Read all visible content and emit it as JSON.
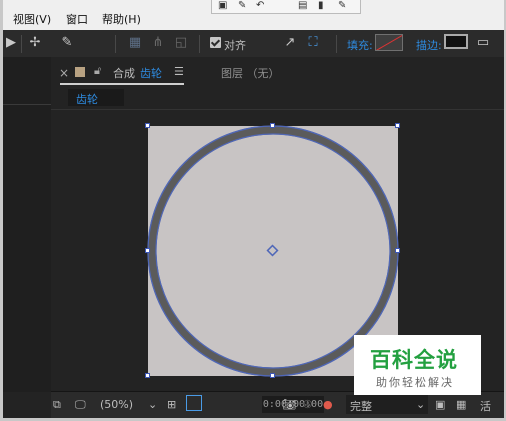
{
  "menu": {
    "items": [
      "视图(V)",
      "窗口",
      "帮助(H)"
    ]
  },
  "toolbar": {
    "align_label": "对齐",
    "fill_label": "填充:",
    "stroke_label": "描边:",
    "tool_icons": [
      "play-icon",
      "puppet-pin-icon",
      "pin-icon",
      "grid-tool-icon",
      "fork-tool-icon",
      "frame-tool-icon",
      "arrow-tool-icon",
      "expand-icon"
    ]
  },
  "panel": {
    "close_glyph": "×",
    "tab_label": "合成",
    "tab_name": "齿轮",
    "menu_glyph": "☰",
    "layer_tab": "图层 （无）",
    "subtab": "齿轮"
  },
  "statusbar": {
    "zoom": "(50%)",
    "timecode": "0:00:00:00",
    "quality": "完整",
    "trailing_text": "活"
  },
  "colors": {
    "accent": "#2e8be0",
    "ring_outer": "#5b5b5b",
    "ring_path": "#4f67b8",
    "comp": "#c8c4c4"
  },
  "watermark": {
    "title": "百科全说",
    "subtitle": "助你轻松解决"
  }
}
